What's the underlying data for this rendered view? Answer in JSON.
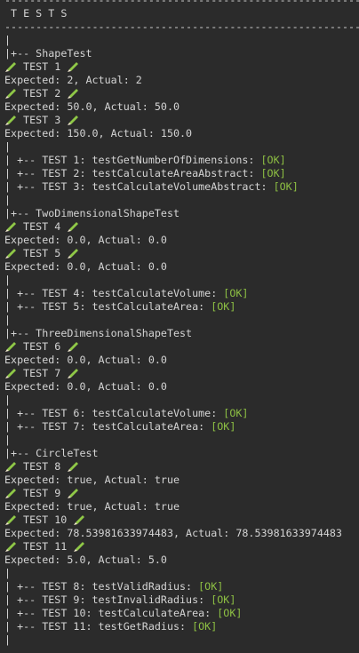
{
  "colors": {
    "background": "#2b2b2b",
    "text": "#d4d4d4",
    "ok": "#8dbf43",
    "pencil_body": "#8fc847",
    "pencil_tip": "#f2e8cf"
  },
  "pencil_icon": "pencil-icon",
  "lines": [
    {
      "type": "text",
      "text": "--------------------------------------------------------------------"
    },
    {
      "type": "text",
      "text": " T E S T S"
    },
    {
      "type": "text",
      "text": "--------------------------------------------------------------------"
    },
    {
      "type": "text",
      "text": "|"
    },
    {
      "type": "text",
      "text": "|+-- ShapeTest"
    },
    {
      "type": "test",
      "text": "TEST 1"
    },
    {
      "type": "text",
      "text": "Expected: 2, Actual: 2"
    },
    {
      "type": "test",
      "text": "TEST 2"
    },
    {
      "type": "text",
      "text": "Expected: 50.0, Actual: 50.0"
    },
    {
      "type": "test",
      "text": "TEST 3"
    },
    {
      "type": "text",
      "text": "Expected: 150.0, Actual: 150.0"
    },
    {
      "type": "text",
      "text": "|"
    },
    {
      "type": "result",
      "text": "| +-- TEST 1: testGetNumberOfDimensions: ",
      "status": "[OK]"
    },
    {
      "type": "result",
      "text": "| +-- TEST 2: testCalculateAreaAbstract: ",
      "status": "[OK]"
    },
    {
      "type": "result",
      "text": "| +-- TEST 3: testCalculateVolumeAbstract: ",
      "status": "[OK]"
    },
    {
      "type": "text",
      "text": "|"
    },
    {
      "type": "text",
      "text": "|+-- TwoDimensionalShapeTest"
    },
    {
      "type": "test",
      "text": "TEST 4"
    },
    {
      "type": "text",
      "text": "Expected: 0.0, Actual: 0.0"
    },
    {
      "type": "test",
      "text": "TEST 5"
    },
    {
      "type": "text",
      "text": "Expected: 0.0, Actual: 0.0"
    },
    {
      "type": "text",
      "text": "|"
    },
    {
      "type": "result",
      "text": "| +-- TEST 4: testCalculateVolume: ",
      "status": "[OK]"
    },
    {
      "type": "result",
      "text": "| +-- TEST 5: testCalculateArea: ",
      "status": "[OK]"
    },
    {
      "type": "text",
      "text": "|"
    },
    {
      "type": "text",
      "text": "|+-- ThreeDimensionalShapeTest"
    },
    {
      "type": "test",
      "text": "TEST 6"
    },
    {
      "type": "text",
      "text": "Expected: 0.0, Actual: 0.0"
    },
    {
      "type": "test",
      "text": "TEST 7"
    },
    {
      "type": "text",
      "text": "Expected: 0.0, Actual: 0.0"
    },
    {
      "type": "text",
      "text": "|"
    },
    {
      "type": "result",
      "text": "| +-- TEST 6: testCalculateVolume: ",
      "status": "[OK]"
    },
    {
      "type": "result",
      "text": "| +-- TEST 7: testCalculateArea: ",
      "status": "[OK]"
    },
    {
      "type": "text",
      "text": "|"
    },
    {
      "type": "text",
      "text": "|+-- CircleTest"
    },
    {
      "type": "test",
      "text": "TEST 8"
    },
    {
      "type": "text",
      "text": "Expected: true, Actual: true"
    },
    {
      "type": "test",
      "text": "TEST 9"
    },
    {
      "type": "text",
      "text": "Expected: true, Actual: true"
    },
    {
      "type": "test",
      "text": "TEST 10"
    },
    {
      "type": "text",
      "text": "Expected: 78.53981633974483, Actual: 78.53981633974483"
    },
    {
      "type": "test",
      "text": "TEST 11"
    },
    {
      "type": "text",
      "text": "Expected: 5.0, Actual: 5.0"
    },
    {
      "type": "text",
      "text": "|"
    },
    {
      "type": "result",
      "text": "| +-- TEST 8: testValidRadius: ",
      "status": "[OK]"
    },
    {
      "type": "result",
      "text": "| +-- TEST 9: testInvalidRadius: ",
      "status": "[OK]"
    },
    {
      "type": "result",
      "text": "| +-- TEST 10: testCalculateArea: ",
      "status": "[OK]"
    },
    {
      "type": "result",
      "text": "| +-- TEST 11: testGetRadius: ",
      "status": "[OK]"
    },
    {
      "type": "text",
      "text": "|"
    }
  ]
}
